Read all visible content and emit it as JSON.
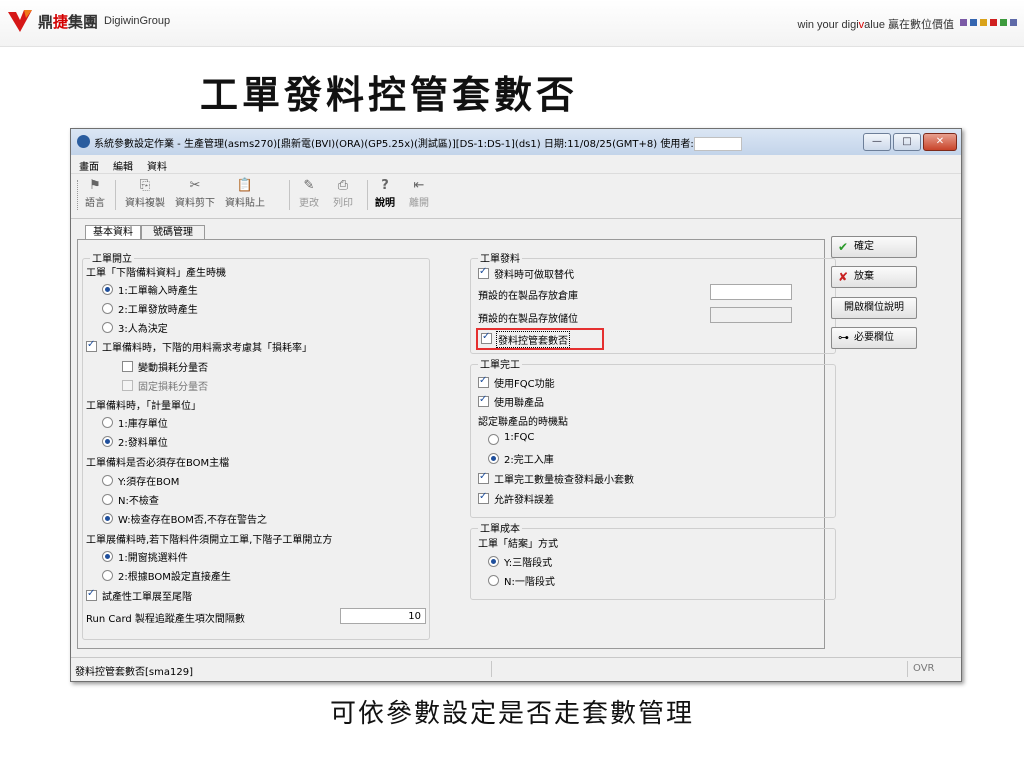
{
  "header": {
    "company_zh": "鼎",
    "company_zh_red": "捷",
    "company_zh_rest": "集團",
    "company_en": "DigiwinGroup",
    "slogan_pre": "win your digi",
    "slogan_v": "v",
    "slogan_post": "alue 贏在數位價值",
    "squares": [
      "#7b5aa6",
      "#3566b0",
      "#d9a21a",
      "#d02020",
      "#3d9a3d",
      "#5f6aa8"
    ]
  },
  "slide_title": "工單發料控管套數否",
  "caption": "可依參數設定是否走套數管理",
  "window": {
    "title": "系統參數設定作業 - 生產管理(asms270)[鼎新電(BVI)(ORA)(GP5.25x)(測試區)][DS-1:DS-1](ds1) 日期:11/08/25(GMT+8) 使用者:",
    "controls": {
      "minimize": "—",
      "maximize": "□",
      "close": "✕"
    }
  },
  "menu": [
    "畫面",
    "編輯",
    "資料"
  ],
  "toolbar": [
    {
      "label": "語言",
      "icon": "⚑",
      "name": "flag-icon",
      "style": "normal"
    },
    {
      "label": "資料複製",
      "icon": "⎘",
      "name": "copy-icon",
      "style": "normal"
    },
    {
      "label": "資料剪下",
      "icon": "✂",
      "name": "scissors-icon",
      "style": "normal"
    },
    {
      "label": "資料貼上",
      "icon": "📋",
      "name": "clipboard-icon",
      "style": "normal"
    },
    {
      "label": "更改",
      "icon": "✎",
      "name": "pencil-icon",
      "style": "dim"
    },
    {
      "label": "列印",
      "icon": "⎙",
      "name": "printer-icon",
      "style": "dim"
    },
    {
      "label": "說明",
      "icon": "?",
      "name": "help-icon",
      "style": "bold"
    },
    {
      "label": "離開",
      "icon": "⇤",
      "name": "exit-icon",
      "style": "dim"
    }
  ],
  "tabs": [
    "基本資料",
    "號碼管理"
  ],
  "left": {
    "group_title": "工單開立",
    "q1": "工單「下階備料資料」產生時機",
    "q1_opts": [
      {
        "label": "1:工單輸入時產生",
        "selected": true
      },
      {
        "label": "2:工單發放時產生",
        "selected": false
      },
      {
        "label": "3:人為決定",
        "selected": false
      }
    ],
    "cb_loss": {
      "label": "工單備料時，下階的用料需求考慮其「損耗率」",
      "checked": true
    },
    "cb_var_loss": {
      "label": "變動損耗分量否",
      "checked": false
    },
    "cb_fixed_loss": {
      "label": "固定損耗分量否",
      "checked": false,
      "disabled": true
    },
    "q2": "工單備料時，「計量單位」",
    "q2_opts": [
      {
        "label": "1:庫存單位",
        "selected": false
      },
      {
        "label": "2:發料單位",
        "selected": true
      }
    ],
    "q3": "工單備料是否必須存在BOM主檔",
    "q3_opts": [
      {
        "label": "Y:須存在BOM",
        "selected": false
      },
      {
        "label": "N:不檢查",
        "selected": false
      },
      {
        "label": "W:檢查存在BOM否,不存在警告之",
        "selected": true
      }
    ],
    "q4": "工單展備料時,若下階料件須開立工單,下階子工單開立方",
    "q4_opts": [
      {
        "label": "1:開窗挑選料件",
        "selected": true
      },
      {
        "label": "2:根據BOM設定直接產生",
        "selected": false
      }
    ],
    "cb_trial": {
      "label": "試產性工單展至尾階",
      "checked": true
    },
    "runcard_label": "Run Card 製程追蹤產生項次間隔數",
    "runcard_value": "10"
  },
  "right": {
    "issue_group": "工單發料",
    "cb_substitute": {
      "label": "發料時可做取替代",
      "checked": true
    },
    "wh_label": "預設的在製品存放倉庫",
    "wh_value": "",
    "loc_label": "預設的在製品存放儲位",
    "loc_value": "",
    "cb_kit": {
      "label": "發料控管套數否",
      "checked": true
    },
    "finish_group": "工單完工",
    "cb_fqc": {
      "label": "使用FQC功能",
      "checked": true
    },
    "cb_joint": {
      "label": "使用聯產品",
      "checked": true
    },
    "timing_label": "認定聯產品的時機點",
    "timing_opts": [
      {
        "label": "1:FQC",
        "selected": false
      },
      {
        "label": "2:完工入庫",
        "selected": true
      }
    ],
    "cb_min_kit": {
      "label": "工單完工數量檢查發料最小套數",
      "checked": true
    },
    "cb_over": {
      "label": "允許發料誤差",
      "checked": true
    },
    "cost_group": "工單成本",
    "close_label": "工單「結案」方式",
    "close_opts": [
      {
        "label": "Y:三階段式",
        "selected": true
      },
      {
        "label": "N:一階段式",
        "selected": false
      }
    ]
  },
  "buttons": {
    "confirm": {
      "label": "確定",
      "icon": "✔",
      "icon_color": "#2a9a2a"
    },
    "abandon": {
      "label": "放棄",
      "icon": "✘",
      "icon_color": "#c82020"
    },
    "field_help": {
      "label": "開啟欄位說明"
    },
    "required": {
      "label": "必要欄位",
      "icon": "⊶"
    }
  },
  "status": {
    "left": "發料控管套數否[sma129]",
    "right": "OVR"
  }
}
